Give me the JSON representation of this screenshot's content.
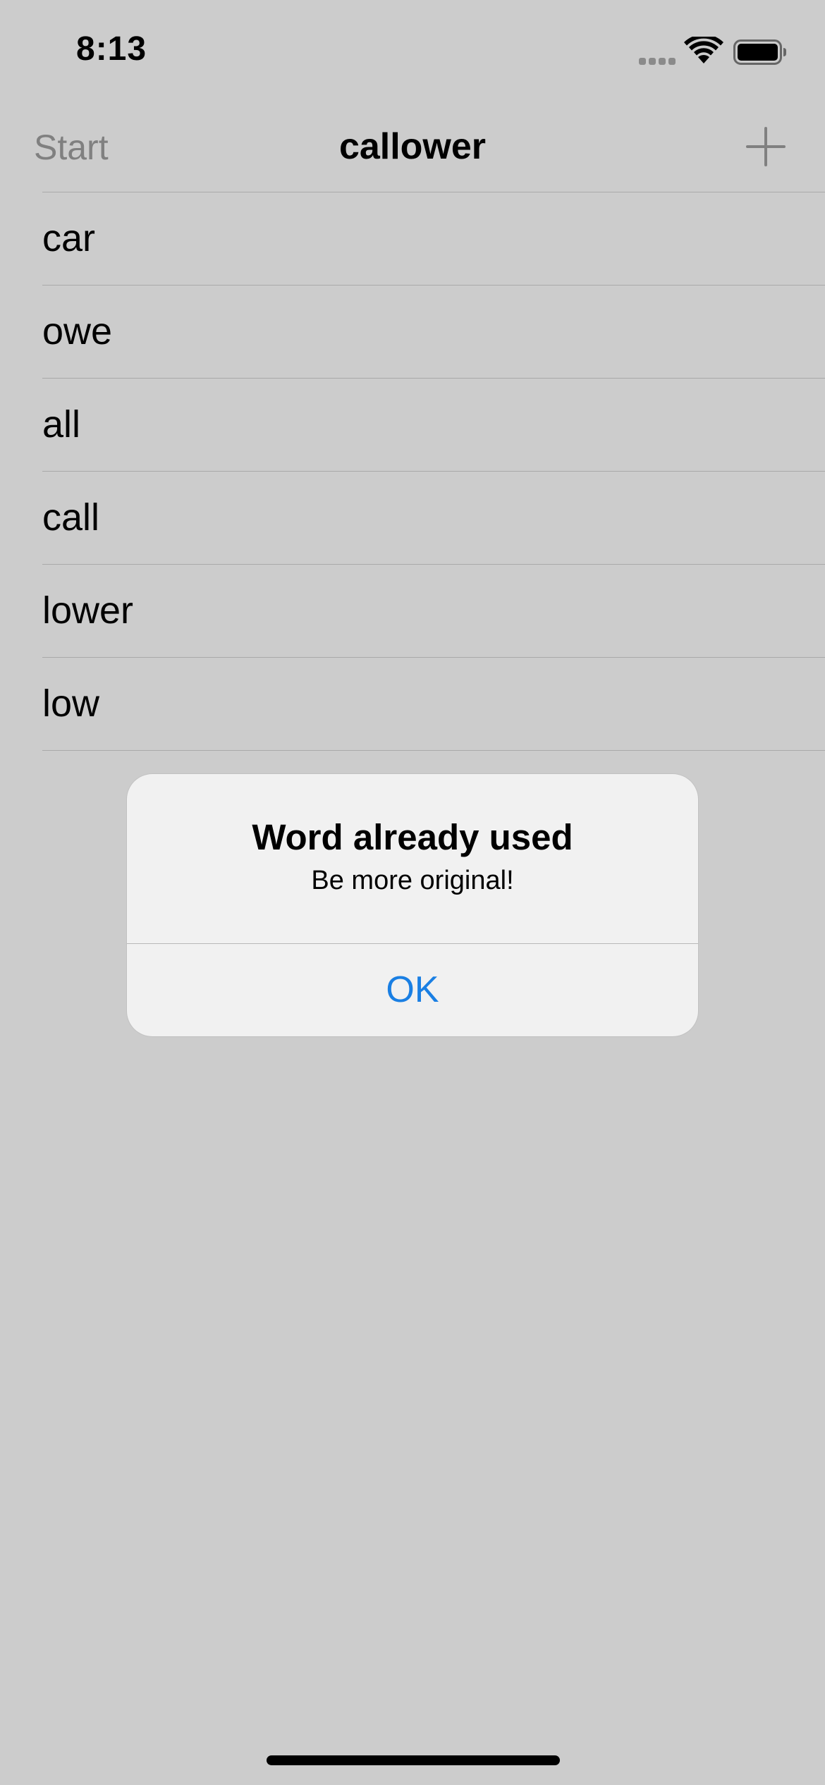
{
  "status_bar": {
    "time": "8:13"
  },
  "nav": {
    "start_label": "Start",
    "title": "callower"
  },
  "words": [
    "car",
    "owe",
    "all",
    "call",
    "lower",
    "low"
  ],
  "alert": {
    "title": "Word already used",
    "message": "Be more original!",
    "ok_label": "OK"
  },
  "colors": {
    "background": "#cccccc",
    "accent": "#1a7fe3",
    "alert_background": "#f1f1f1"
  }
}
